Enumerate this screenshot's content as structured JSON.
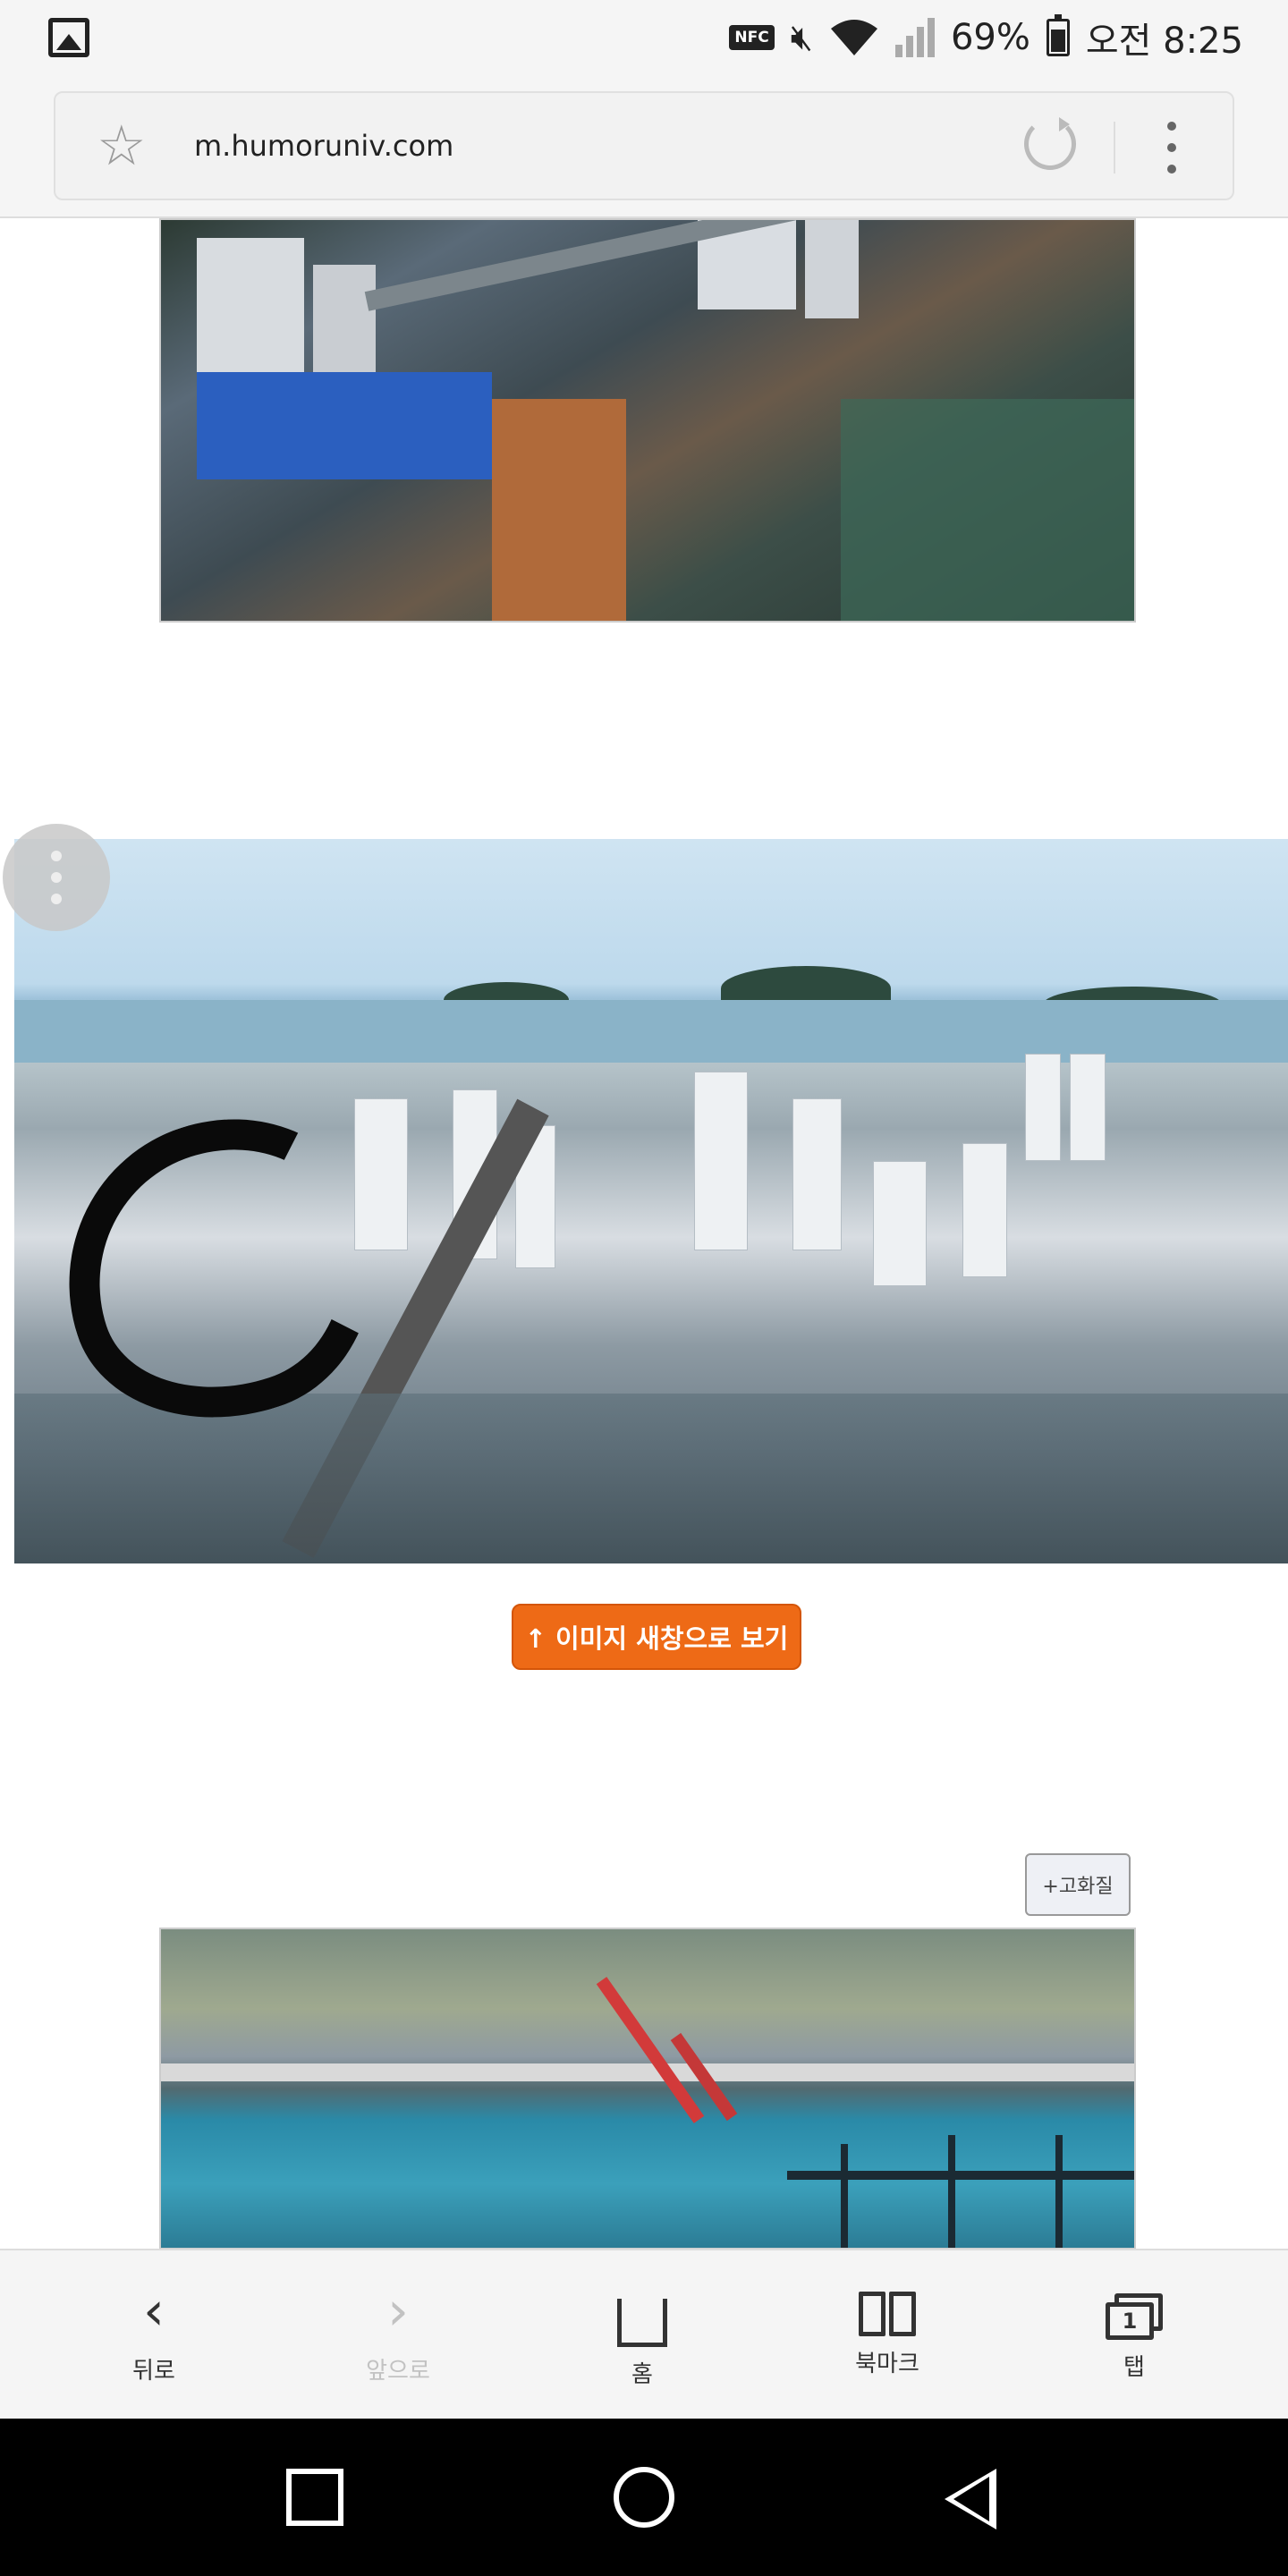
{
  "status_bar": {
    "nfc_label": "NFC",
    "battery_percent": "69%",
    "time": "오전 8:25",
    "icons": [
      "gallery-icon",
      "nfc-icon",
      "mute-icon",
      "wifi-icon",
      "signal-icon",
      "battery-icon"
    ]
  },
  "browser": {
    "url": "m.humoruniv.com",
    "icons": [
      "star-icon",
      "reload-icon",
      "menu-icon"
    ]
  },
  "content": {
    "open_image_button": "↑ 이미지 새창으로 보기",
    "hq_button": "+고화질",
    "images": [
      "city-aerial-image",
      "busan-panorama-image",
      "harbor-image"
    ]
  },
  "toolbar": {
    "items": [
      {
        "label": "뒤로",
        "icon": "back-icon"
      },
      {
        "label": "앞으로",
        "icon": "forward-icon",
        "disabled": true
      },
      {
        "label": "홈",
        "icon": "home-icon"
      },
      {
        "label": "북마크",
        "icon": "bookmark-icon"
      },
      {
        "label": "탭",
        "icon": "tabs-icon",
        "tab_count": "1"
      }
    ]
  },
  "nav_bar": {
    "icons": [
      "recents-icon",
      "home-circle-icon",
      "back-triangle-icon"
    ]
  },
  "colors": {
    "accent": "#ee6a16",
    "toolbar_bg": "#f5f5f5",
    "nav_bg": "#000000"
  }
}
